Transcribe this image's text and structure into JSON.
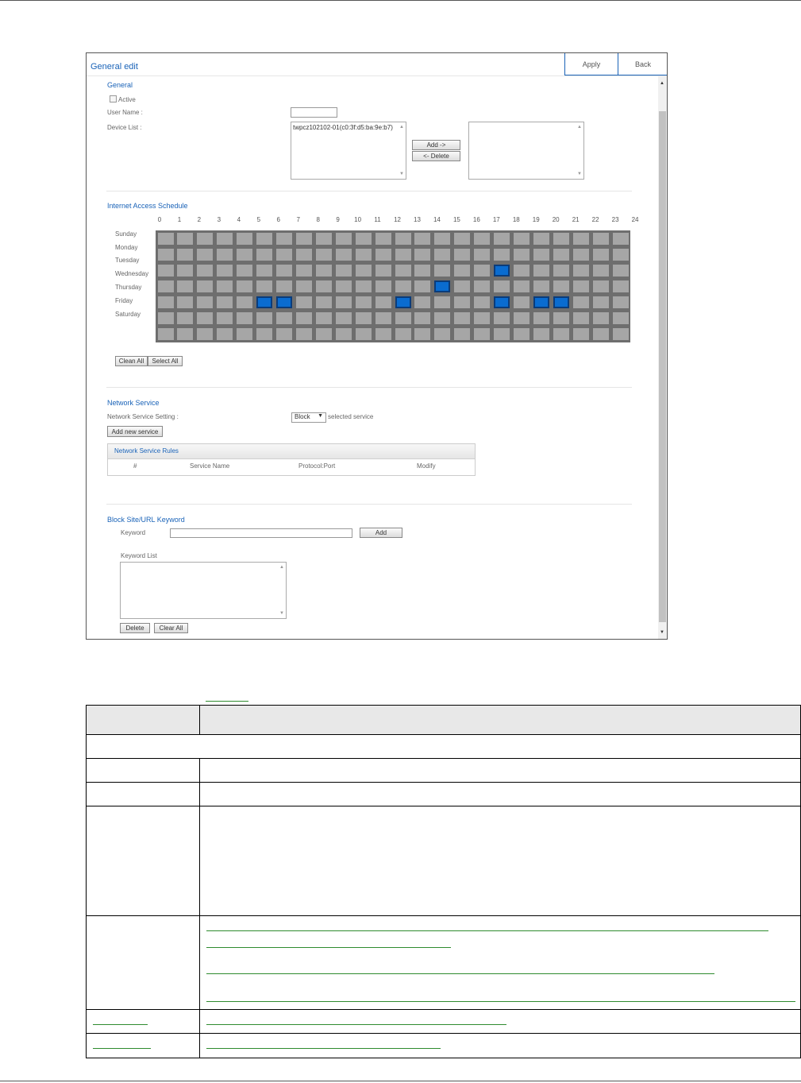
{
  "window": {
    "title": "General edit",
    "apply_label": "Apply",
    "back_label": "Back"
  },
  "general": {
    "heading": "General",
    "active_label": "Active",
    "user_name_label": "User Name :",
    "user_name_value": "",
    "device_list_label": "Device List :",
    "available_devices": [
      "twpcz102102-01(c0:3f:d5:ba:9e:b7)"
    ],
    "add_label": "Add ->",
    "delete_label": "<- Delete",
    "selected_devices": []
  },
  "schedule": {
    "heading": "Internet Access Schedule",
    "hours": [
      "0",
      "1",
      "2",
      "3",
      "4",
      "5",
      "6",
      "7",
      "8",
      "9",
      "10",
      "11",
      "12",
      "13",
      "14",
      "15",
      "16",
      "17",
      "18",
      "19",
      "20",
      "21",
      "22",
      "23",
      "24"
    ],
    "days": [
      "Sunday",
      "Monday",
      "Tuesday",
      "Wednesday",
      "Thursday",
      "Friday",
      "Saturday"
    ],
    "selected_cells": [
      {
        "row": 2,
        "hour": 17
      },
      {
        "row": 3,
        "hour": 14
      },
      {
        "row": 4,
        "hour": 5
      },
      {
        "row": 4,
        "hour": 6
      },
      {
        "row": 4,
        "hour": 12
      },
      {
        "row": 4,
        "hour": 17
      },
      {
        "row": 4,
        "hour": 19
      },
      {
        "row": 4,
        "hour": 20
      }
    ],
    "clean_all_label": "Clean All",
    "select_all_label": "Select All"
  },
  "network_service": {
    "heading": "Network Service",
    "setting_label": "Network Service Setting :",
    "setting_value": "Block",
    "setting_suffix": "selected service",
    "add_service_label": "Add new service",
    "rules_title": "Network Service Rules",
    "columns": [
      "#",
      "Service Name",
      "Protocol:Port",
      "Modify"
    ]
  },
  "block_site": {
    "heading": "Block Site/URL Keyword",
    "keyword_label": "Keyword",
    "keyword_value": "",
    "add_label": "Add",
    "keyword_list_label": "Keyword List",
    "keywords": [],
    "delete_label": "Delete",
    "clear_all_label": "Clear All"
  },
  "colors": {
    "accent": "#1a63b8",
    "cell_on": "#0a6cd0",
    "cell_off": "#a6a6a6",
    "grid_bg": "#6e6e6e",
    "link_underline": "#2e8b2e"
  }
}
